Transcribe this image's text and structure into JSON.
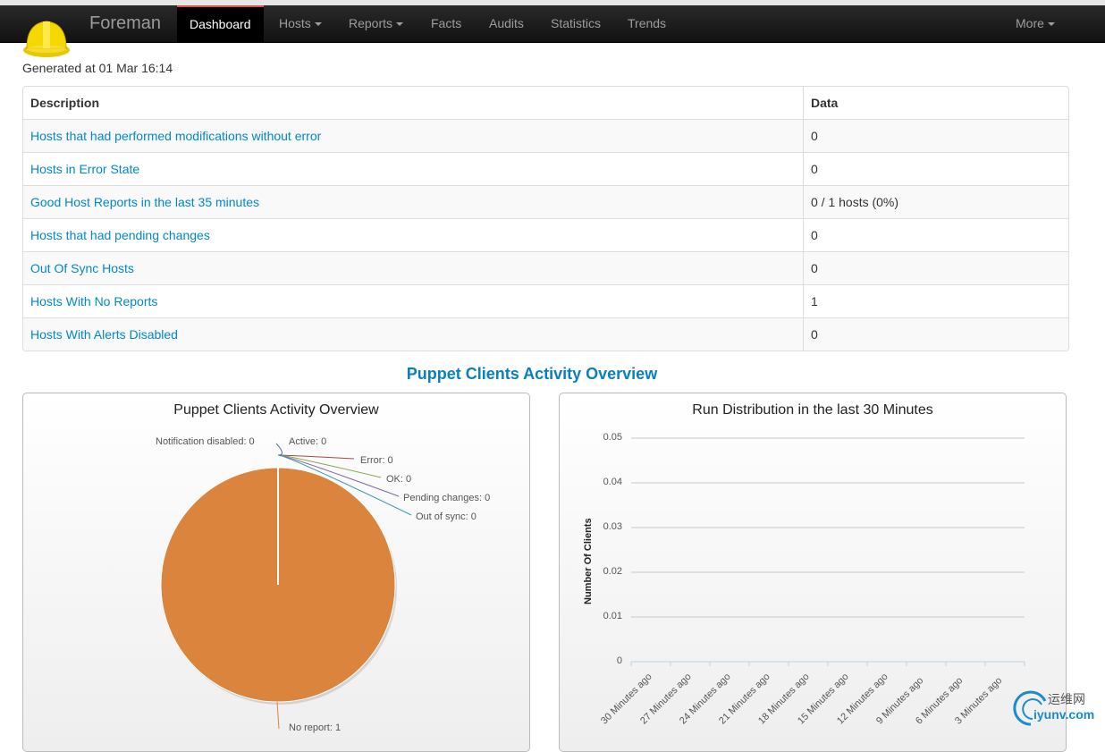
{
  "navbar": {
    "brand": "Foreman",
    "items": [
      {
        "label": "Dashboard",
        "active": true,
        "dropdown": false
      },
      {
        "label": "Hosts",
        "dropdown": true
      },
      {
        "label": "Reports",
        "dropdown": true
      },
      {
        "label": "Facts",
        "dropdown": false
      },
      {
        "label": "Audits",
        "dropdown": false
      },
      {
        "label": "Statistics",
        "dropdown": false
      },
      {
        "label": "Trends",
        "dropdown": false
      }
    ],
    "more_label": "More"
  },
  "generated": "Generated at 01 Mar 16:14",
  "table": {
    "headers": [
      "Description",
      "Data"
    ],
    "rows": [
      {
        "description": "Hosts that had performed modifications without error",
        "data": "0"
      },
      {
        "description": "Hosts in Error State",
        "data": "0"
      },
      {
        "description": "Good Host Reports in the last 35 minutes",
        "data": "0 / 1 hosts (0%)"
      },
      {
        "description": "Hosts that had pending changes",
        "data": "0"
      },
      {
        "description": "Out Of Sync Hosts",
        "data": "0"
      },
      {
        "description": "Hosts With No Reports",
        "data": "1"
      },
      {
        "description": "Hosts With Alerts Disabled",
        "data": "0"
      }
    ]
  },
  "section_title": "Puppet Clients Activity Overview",
  "colors": {
    "pie_no_report": "#db843d",
    "link": "#0088cc",
    "nav_active_border": "#d9534f"
  },
  "chart_data": [
    {
      "type": "pie",
      "title": "Puppet Clients Activity Overview",
      "slices": [
        {
          "label": "Notification disabled",
          "value": 0,
          "display": "Notification disabled: 0"
        },
        {
          "label": "Active",
          "value": 0,
          "display": "Active: 0"
        },
        {
          "label": "Error",
          "value": 0,
          "display": "Error: 0"
        },
        {
          "label": "OK",
          "value": 0,
          "display": "OK: 0"
        },
        {
          "label": "Pending changes",
          "value": 0,
          "display": "Pending changes: 0"
        },
        {
          "label": "Out of sync",
          "value": 0,
          "display": "Out of sync: 0"
        },
        {
          "label": "No report",
          "value": 1,
          "display": "No report: 1"
        }
      ]
    },
    {
      "type": "bar",
      "title": "Run Distribution in the last 30 Minutes",
      "ylabel": "Number Of Clients",
      "yticks": [
        "0.05",
        "0.04",
        "0.03",
        "0.02",
        "0.01",
        "0"
      ],
      "ylim": [
        0,
        0.05
      ],
      "categories": [
        "30 Minutes ago",
        "27 Minutes ago",
        "24 Minutes ago",
        "21 Minutes ago",
        "18 Minutes ago",
        "15 Minutes ago",
        "12 Minutes ago",
        "9 Minutes ago",
        "6 Minutes ago",
        "3 Minutes ago"
      ],
      "values": [
        0,
        0,
        0,
        0,
        0,
        0,
        0,
        0,
        0,
        0
      ],
      "grid": true
    }
  ],
  "watermark": {
    "cn": "运维网",
    "en": "iyunv.com"
  }
}
